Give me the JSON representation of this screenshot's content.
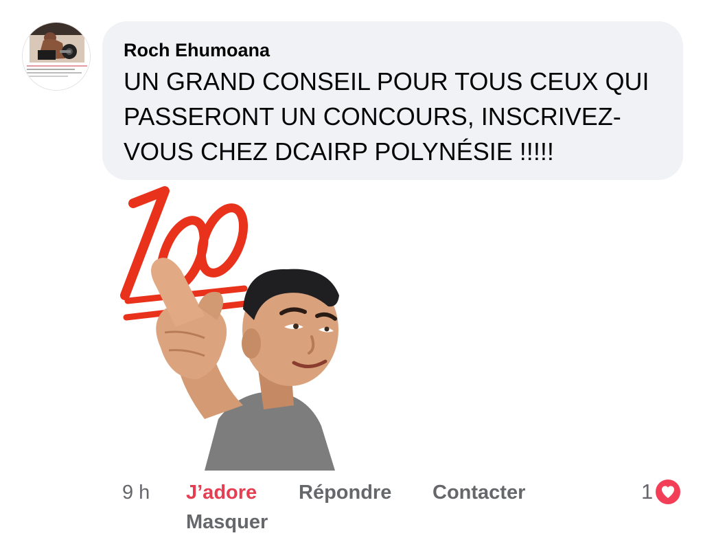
{
  "comment": {
    "author": "Roch Ehumoana",
    "text": "UN GRAND CONSEIL POUR TOUS CEUX QUI PASSERONT UN CONCOURS, INSCRIVEZ-VOUS CHEZ DCAIRP POLYNÉSIE !!!!!"
  },
  "sticker": {
    "label": "100",
    "icon": "hundred-points-avatar-sticker"
  },
  "actions": {
    "time": "9 h",
    "like_label": "J’adore",
    "reply_label": "Répondre",
    "contact_label": "Contacter",
    "hide_label": "Masquer"
  },
  "reactions": {
    "count": "1",
    "icon": "heart-icon"
  },
  "colors": {
    "bubble": "#f0f2f5",
    "text": "#050505",
    "muted": "#65676b",
    "like_active": "#e53e52",
    "heart_badge": "#f33e58",
    "sticker_red": "#e8321b"
  }
}
